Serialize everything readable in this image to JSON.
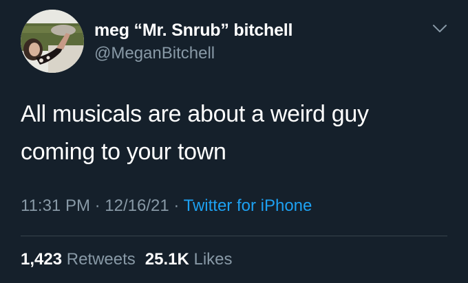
{
  "tweet": {
    "display_name": "meg “Mr. Snrub” bitchell",
    "handle": "@MeganBitchell",
    "text_line1": "All musicals are about a weird guy",
    "text_line2": "coming to your town",
    "time": "11:31 PM",
    "date": "12/16/21",
    "separator": " · ",
    "source": "Twitter for iPhone",
    "retweets_count": "1,423",
    "retweets_label": "Retweets",
    "likes_count": "25.1K",
    "likes_label": "Likes"
  },
  "icons": {
    "avatar": "profile-photo",
    "menu": "chevron-down-icon"
  },
  "colors": {
    "background": "#15202b",
    "text": "#ffffff",
    "secondary": "#8899a6",
    "link": "#1da1f2",
    "divider": "#38444d"
  }
}
